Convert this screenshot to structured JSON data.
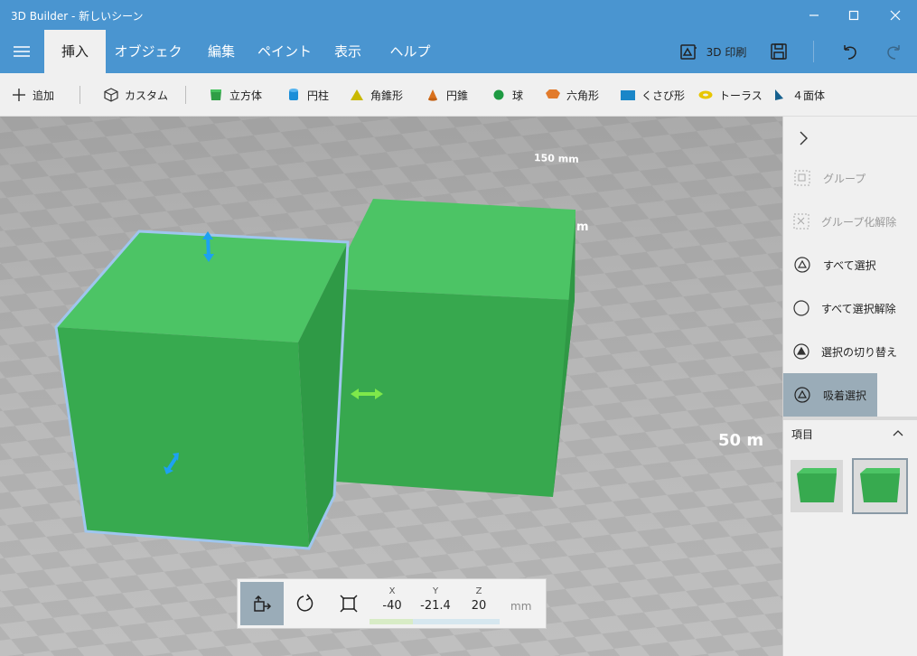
{
  "window": {
    "title": "3D Builder - 新しいシーン"
  },
  "ribbon": {
    "tabs": [
      {
        "label": "挿入"
      },
      {
        "label": "オブジェクト"
      },
      {
        "label": "編集"
      },
      {
        "label": "ペイント"
      },
      {
        "label": "表示"
      },
      {
        "label": "ヘルプ"
      }
    ],
    "active_tab": "挿入",
    "print_label": "3D 印刷"
  },
  "shapebar": {
    "add_label": "追加",
    "custom_label": "カスタム",
    "shapes": [
      {
        "label": "立方体",
        "icon": "cube-icon"
      },
      {
        "label": "円柱",
        "icon": "cylinder-icon"
      },
      {
        "label": "角錐形",
        "icon": "pyramid-icon"
      },
      {
        "label": "円錐",
        "icon": "cone-icon"
      },
      {
        "label": "球",
        "icon": "sphere-icon"
      },
      {
        "label": "六角形",
        "icon": "hexagon-icon"
      },
      {
        "label": "くさび形",
        "icon": "wedge-icon"
      },
      {
        "label": "トーラス",
        "icon": "torus-icon"
      },
      {
        "label": "４面体",
        "icon": "tetrahedron-icon"
      }
    ]
  },
  "viewport": {
    "labels": [
      "150 mm",
      "m",
      "50 m"
    ]
  },
  "coords": {
    "x_label": "X",
    "y_label": "Y",
    "z_label": "Z",
    "x": "-40",
    "y": "-21.4",
    "z": "20",
    "unit": "mm"
  },
  "panel": {
    "items": [
      {
        "label": "グループ",
        "state": "disabled"
      },
      {
        "label": "グループ化解除",
        "state": "disabled"
      },
      {
        "label": "すべて選択",
        "state": "normal"
      },
      {
        "label": "すべて選択解除",
        "state": "normal"
      },
      {
        "label": "選択の切り替え",
        "state": "normal"
      },
      {
        "label": "吸着選択",
        "state": "active"
      }
    ],
    "items_header": "項目"
  },
  "colors": {
    "titlebar": "#4a95d0",
    "cube_green": "#44bb5a",
    "selection_outline": "#9fc6ee",
    "active_tool": "#9aacb8"
  }
}
